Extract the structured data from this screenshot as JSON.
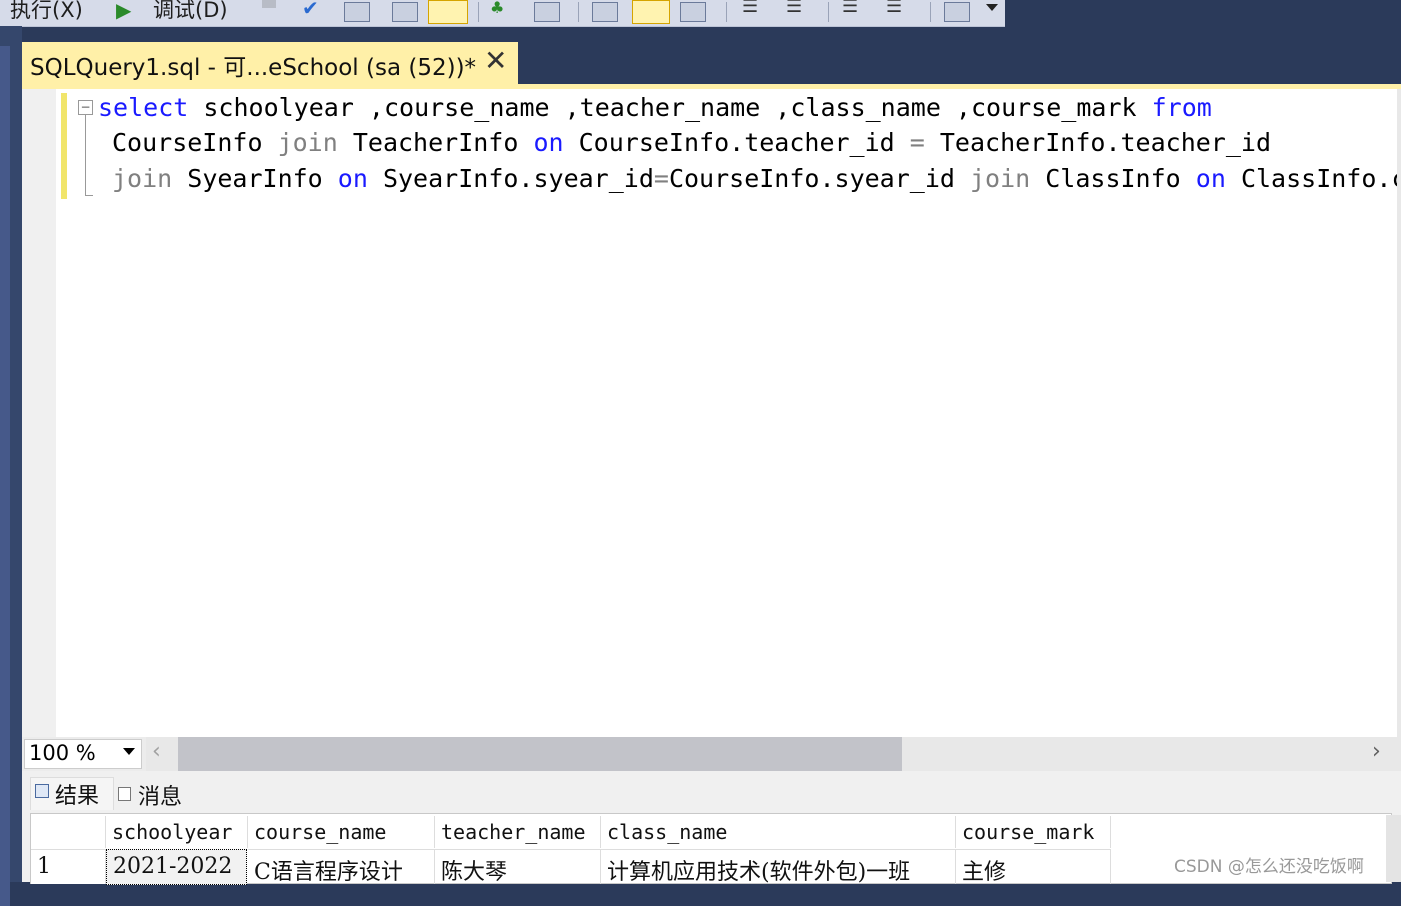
{
  "toolbar": {
    "execute_label": "执行(X)",
    "debug_label": "调试(D)"
  },
  "tab": {
    "title": "SQLQuery1.sql - 可...eSchool (sa (52))*",
    "close_glyph": "✕"
  },
  "editor": {
    "line1": {
      "kw_select": "select",
      "rest": " schoolyear ,course_name ,teacher_name ,class_name ,course_mark ",
      "kw_from": "from"
    },
    "line2": {
      "t1": "CourseInfo ",
      "join": "join",
      "t2": " TeacherInfo ",
      "on": "on",
      "t3": " CourseInfo.teacher_id ",
      "eq": "=",
      "t4": " TeacherInfo.teacher_id"
    },
    "line3": {
      "join1": "join",
      "t1": " SyearInfo ",
      "on1": "on",
      "t2": " SyearInfo.syear_id",
      "eq": "=",
      "t3": "CourseInfo.syear_id ",
      "join2": "join",
      "t4": " ClassInfo ",
      "on2": "on",
      "t5": " ClassInfo.c"
    }
  },
  "zoom": {
    "value": "100 %"
  },
  "results": {
    "tabs": [
      "结果",
      "消息"
    ],
    "columns": [
      "schoolyear",
      "course_name",
      "teacher_name",
      "class_name",
      "course_mark"
    ],
    "rows": [
      {
        "index": "1",
        "cells": [
          "2021-2022",
          "C语言程序设计",
          "陈大琴",
          "计算机应用技术(软件外包)一班",
          "主修"
        ]
      }
    ]
  },
  "watermark": "CSDN @怎么还没吃饭啊"
}
